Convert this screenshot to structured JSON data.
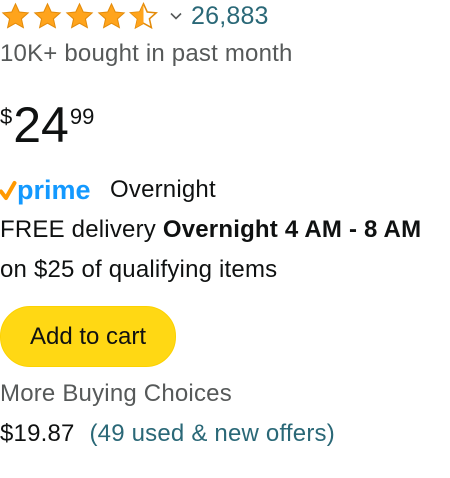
{
  "rating": {
    "stars": 4.5,
    "star_icon": "star-icon",
    "star_color": "#FFA41C",
    "dropdown_icon": "chevron-down-icon",
    "review_count": "26,883"
  },
  "bought_text": "10K+ bought in past month",
  "price": {
    "symbol": "$",
    "whole": "24",
    "fraction": "99"
  },
  "prime": {
    "logo_icon": "prime-logo-icon",
    "check_color": "#FF9900",
    "word_color": "#1399FF",
    "logo_text": "prime",
    "speed_label": "Overnight"
  },
  "delivery": {
    "prefix": "FREE delivery ",
    "window": "Overnight 4 AM - 8 AM",
    "suffix": " on $25 of qualifying items"
  },
  "add_to_cart": {
    "label": "Add to cart",
    "color": "#FFD814"
  },
  "more_buying_choices": {
    "heading": "More Buying Choices",
    "price": "$19.87",
    "offers_link": "(49 used & new offers)"
  },
  "colors": {
    "text": "#0F1111",
    "muted": "#565959",
    "link": "#2A6877"
  }
}
